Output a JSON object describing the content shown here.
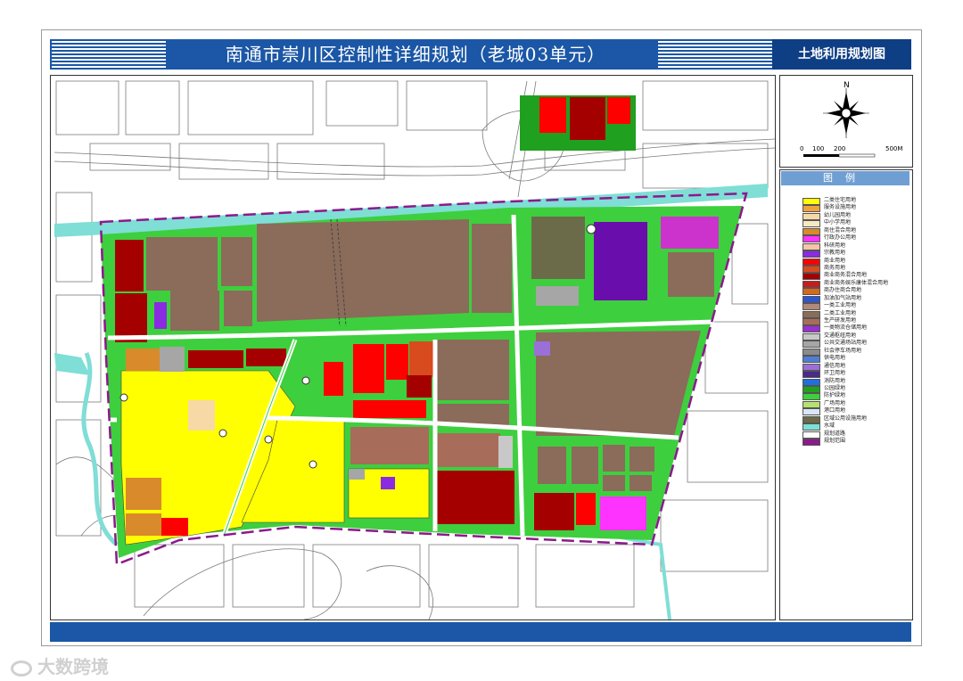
{
  "title": "南通市崇川区控制性详细规划（老城03单元）",
  "map_type": "土地利用规划图",
  "north_label": "N",
  "scale_ticks": [
    "0",
    "100",
    "200",
    "500M"
  ],
  "legend_title": "图例",
  "legend": [
    {
      "label": "二类住宅用地",
      "color": "#ffff00"
    },
    {
      "label": "服务设施用地",
      "color": "#f2a23c"
    },
    {
      "label": "幼儿园用地",
      "color": "#f7d9a6"
    },
    {
      "label": "中小学用地",
      "color": "#f7e8c4"
    },
    {
      "label": "商住混合用地",
      "color": "#d98a2b"
    },
    {
      "label": "行政办公用地",
      "color": "#ff33ff"
    },
    {
      "label": "科研用地",
      "color": "#f4c5a8"
    },
    {
      "label": "宗教用地",
      "color": "#8a2be2"
    },
    {
      "label": "商业用地",
      "color": "#ff0000"
    },
    {
      "label": "商务用地",
      "color": "#d84b1e"
    },
    {
      "label": "商业商务混合用地",
      "color": "#a50000"
    },
    {
      "label": "商业商务娱乐康体混合用地",
      "color": "#c41e1e"
    },
    {
      "label": "商办住商合用地",
      "color": "#d2691e"
    },
    {
      "label": "加油加气站用地",
      "color": "#3355cc"
    },
    {
      "label": "一类工业用地",
      "color": "#b08a78"
    },
    {
      "label": "二类工业用地",
      "color": "#8b6b5a"
    },
    {
      "label": "生产研发用地",
      "color": "#a86c5a"
    },
    {
      "label": "一类物流仓储用地",
      "color": "#9932cc"
    },
    {
      "label": "交通枢纽用地",
      "color": "#c8c8c8"
    },
    {
      "label": "公共交通场站用地",
      "color": "#a6a6a6"
    },
    {
      "label": "社会停车场用地",
      "color": "#8c8c8c"
    },
    {
      "label": "供电用地",
      "color": "#4f7fd0"
    },
    {
      "label": "通信用地",
      "color": "#9b6fd8"
    },
    {
      "label": "环卫用地",
      "color": "#4b2a8a"
    },
    {
      "label": "消防用地",
      "color": "#1f6fdc"
    },
    {
      "label": "公园绿地",
      "color": "#1fa01f"
    },
    {
      "label": "防护绿地",
      "color": "#3ecf3e"
    },
    {
      "label": "广场用地",
      "color": "#b5e26e"
    },
    {
      "label": "港口用地",
      "color": "#d9e6f5"
    },
    {
      "label": "区域公用设施用地",
      "color": "#6b6b4a"
    },
    {
      "label": "水域",
      "color": "#7fded6"
    },
    {
      "label": "规划道路",
      "color": "#ffffff"
    },
    {
      "label": "规划范围",
      "color": "#8b1a8b"
    }
  ],
  "watermark": "大数跨境"
}
